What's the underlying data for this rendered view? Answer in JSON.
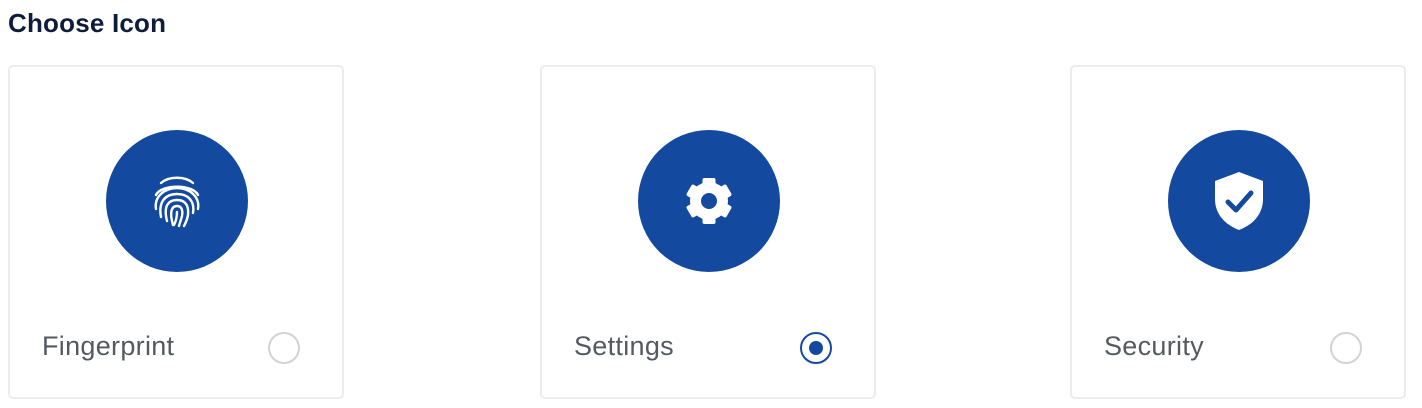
{
  "heading": "Choose Icon",
  "colors": {
    "accent": "#134aa0",
    "card_border": "#ececee",
    "label_text": "#555a62",
    "heading_text": "#0f1c3a"
  },
  "options": [
    {
      "label": "Fingerprint",
      "icon": "fingerprint-icon",
      "selected": false
    },
    {
      "label": "Settings",
      "icon": "gear-icon",
      "selected": true
    },
    {
      "label": "Security",
      "icon": "shield-check-icon",
      "selected": false
    }
  ],
  "selected_option": "Settings"
}
